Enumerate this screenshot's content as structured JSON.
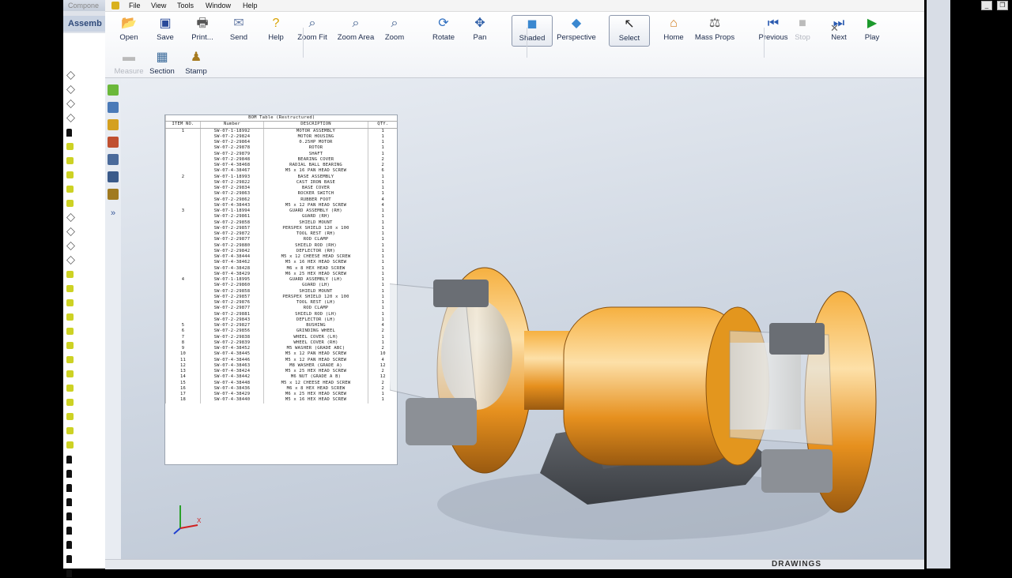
{
  "back_window": {
    "strip_label": "Compone",
    "tab_label": "Assemb"
  },
  "menu": [
    "File",
    "View",
    "Tools",
    "Window",
    "Help"
  ],
  "toolbar": {
    "row1": [
      {
        "label": "Open",
        "icon": "open-icon",
        "glyph": "📂",
        "color": "#d6a22a"
      },
      {
        "label": "Save",
        "icon": "save-icon",
        "glyph": "▣",
        "color": "#2a4a9a"
      },
      {
        "label": "Print...",
        "icon": "print-icon",
        "glyph": "🖶",
        "color": "#555"
      },
      {
        "label": "Send",
        "icon": "send-icon",
        "glyph": "✉",
        "color": "#6a7fa8"
      },
      {
        "label": "Help",
        "icon": "help-icon",
        "glyph": "?",
        "color": "#d9a200"
      },
      {
        "label": "Zoom Fit",
        "icon": "zoom-fit-icon",
        "glyph": "⌕",
        "color": "#3a5a8a"
      },
      {
        "label": "Zoom Area",
        "icon": "zoom-area-icon",
        "glyph": "⌕",
        "color": "#3a5a8a"
      },
      {
        "label": "Zoom",
        "icon": "zoom-icon",
        "glyph": "⌕",
        "color": "#3a5a8a"
      },
      {
        "label": "Rotate",
        "icon": "rotate-icon",
        "glyph": "⟳",
        "color": "#2f6fc0"
      },
      {
        "label": "Pan",
        "icon": "pan-icon",
        "glyph": "✥",
        "color": "#2f5fa8"
      },
      {
        "label": "Shaded",
        "icon": "shaded-icon",
        "glyph": "◼",
        "color": "#3a88d0"
      },
      {
        "label": "Perspective",
        "icon": "perspective-icon",
        "glyph": "◆",
        "color": "#3a88d0"
      },
      {
        "label": "Select",
        "icon": "select-icon",
        "glyph": "↖",
        "color": "#222"
      },
      {
        "label": "Home",
        "icon": "home-icon",
        "glyph": "⌂",
        "color": "#d07a1a"
      },
      {
        "label": "Mass Props",
        "icon": "mass-props-icon",
        "glyph": "⚖",
        "color": "#555"
      },
      {
        "label": "Previous",
        "icon": "previous-icon",
        "glyph": "⏮",
        "color": "#2a5ab0"
      },
      {
        "label": "Stop",
        "icon": "stop-icon",
        "glyph": "■",
        "color": "#bbb"
      },
      {
        "label": "Next",
        "icon": "next-icon",
        "glyph": "⏭",
        "color": "#2a5ab0"
      },
      {
        "label": "Play",
        "icon": "play-icon",
        "glyph": "▶",
        "color": "#1c9a2c"
      }
    ],
    "row2": [
      {
        "label": "Measure",
        "icon": "measure-icon",
        "glyph": "▬",
        "color": "#bbb"
      },
      {
        "label": "Section",
        "icon": "section-icon",
        "glyph": "▦",
        "color": "#3a6a9a"
      },
      {
        "label": "Stamp",
        "icon": "stamp-icon",
        "glyph": "♟",
        "color": "#a67a20"
      }
    ]
  },
  "bom": {
    "title": "BOM Table (Restructured)",
    "columns": [
      "ITEM NO.",
      "Number",
      "DESCRIPTION",
      "QTY."
    ],
    "rows": [
      [
        "1",
        "SW-07-1-18992",
        "MOTOR ASSEMBLY",
        "1"
      ],
      [
        "",
        "SW-07-2-29824",
        "MOTOR HOUSING",
        "1"
      ],
      [
        "",
        "SW-07-2-29864",
        "0.25HP MOTOR",
        "1"
      ],
      [
        "",
        "SW-07-2-29878",
        "ROTOR",
        "1"
      ],
      [
        "",
        "SW-07-2-29879",
        "SHAFT",
        "1"
      ],
      [
        "",
        "SW-07-2-29848",
        "BEARING COVER",
        "2"
      ],
      [
        "",
        "SW-07-4-38468",
        "RADIAL BALL BEARING",
        "2"
      ],
      [
        "",
        "SW-07-4-38467",
        "M5 x 16 PAN HEAD SCREW",
        "6"
      ],
      [
        "2",
        "SW-07-1-18993",
        "BASE ASSEMBLY",
        "1"
      ],
      [
        "",
        "SW-07-2-29822",
        "CAST IRON BASE",
        "1"
      ],
      [
        "",
        "SW-07-2-29834",
        "BASE COVER",
        "1"
      ],
      [
        "",
        "SW-07-2-29863",
        "ROCKER SWITCH",
        "1"
      ],
      [
        "",
        "SW-07-2-29862",
        "RUBBER FOOT",
        "4"
      ],
      [
        "",
        "SW-07-4-38443",
        "M5 x 12 PAN HEAD SCREW",
        "4"
      ],
      [
        "3",
        "SW-07-1-18994",
        "GUARD ASSEMBLY (RH)",
        "1"
      ],
      [
        "",
        "SW-07-2-29861",
        "GUARD (RH)",
        "1"
      ],
      [
        "",
        "SW-07-2-29858",
        "SHIELD MOUNT",
        "1"
      ],
      [
        "",
        "SW-07-2-29857",
        "PERSPEX SHIELD 120 x 100",
        "1"
      ],
      [
        "",
        "SW-07-2-29872",
        "TOOL REST (RH)",
        "1"
      ],
      [
        "",
        "SW-07-2-29877",
        "ROD CLAMP",
        "1"
      ],
      [
        "",
        "SW-07-2-29880",
        "SHIELD ROD (RH)",
        "1"
      ],
      [
        "",
        "SW-07-2-29842",
        "DEFLECTOR (RH)",
        "1"
      ],
      [
        "",
        "SW-07-4-38444",
        "M5 x 12 CHEESE HEAD SCREW",
        "1"
      ],
      [
        "",
        "SW-07-4-38462",
        "M5 x 16 HEX HEAD SCREW",
        "1"
      ],
      [
        "",
        "SW-07-4-38428",
        "M6 x 8 HEX HEAD SCREW",
        "1"
      ],
      [
        "",
        "SW-07-4-38429",
        "M6 x 25 HEX HEAD SCREW",
        "1"
      ],
      [
        "4",
        "SW-07-1-18995",
        "GUARD ASSEMBLY (LH)",
        "1"
      ],
      [
        "",
        "SW-07-2-29860",
        "GUARD (LH)",
        "1"
      ],
      [
        "",
        "SW-07-2-29858",
        "SHIELD MOUNT",
        "1"
      ],
      [
        "",
        "SW-07-2-29857",
        "PERSPEX SHIELD 120 x 100",
        "1"
      ],
      [
        "",
        "SW-07-2-29876",
        "TOOL REST (LH)",
        "1"
      ],
      [
        "",
        "SW-07-2-29877",
        "ROD CLAMP",
        "1"
      ],
      [
        "",
        "SW-07-2-29881",
        "SHIELD ROD (LH)",
        "1"
      ],
      [
        "",
        "SW-07-2-29843",
        "DEFLECTOR (LH)",
        "1"
      ],
      [
        "5",
        "SW-07-2-29827",
        "BUSHING",
        "4"
      ],
      [
        "6",
        "SW-07-2-29856",
        "GRINDING WHEEL",
        "2"
      ],
      [
        "7",
        "SW-07-2-29838",
        "WHEEL COVER (LH)",
        "1"
      ],
      [
        "8",
        "SW-07-2-29839",
        "WHEEL COVER (RH)",
        "1"
      ],
      [
        "9",
        "SW-07-4-38452",
        "M5 WASHER (GRADE ABC)",
        "2"
      ],
      [
        "10",
        "SW-07-4-38445",
        "M5 x 12 PAN HEAD SCREW",
        "10"
      ],
      [
        "11",
        "SW-07-4-38446",
        "M5 x 12 PAN HEAD SCREW",
        "4"
      ],
      [
        "12",
        "SW-07-4-38463",
        "M8 WASHER (GRADE A)",
        "12"
      ],
      [
        "13",
        "SW-07-4-38424",
        "M5 x 25 HEX HEAD SCREW",
        "2"
      ],
      [
        "14",
        "SW-07-4-38442",
        "M6 NUT (GRADE A B)",
        "12"
      ],
      [
        "15",
        "SW-07-4-38448",
        "M5 x 12 CHEESE HEAD SCREW",
        "2"
      ],
      [
        "16",
        "SW-07-4-38436",
        "M6 x 8 HEX HEAD SCREW",
        "2"
      ],
      [
        "17",
        "SW-07-4-38429",
        "M6 x 25 HEX HEAD SCREW",
        "1"
      ],
      [
        "18",
        "SW-07-4-38440",
        "M5 x 16 HEX HEAD SCREW",
        "1"
      ]
    ]
  },
  "status": {
    "brand": "DRAWINGS"
  },
  "window_controls": [
    "_",
    "❐",
    "✕"
  ],
  "close_pane": "✕",
  "triad_label": "X"
}
